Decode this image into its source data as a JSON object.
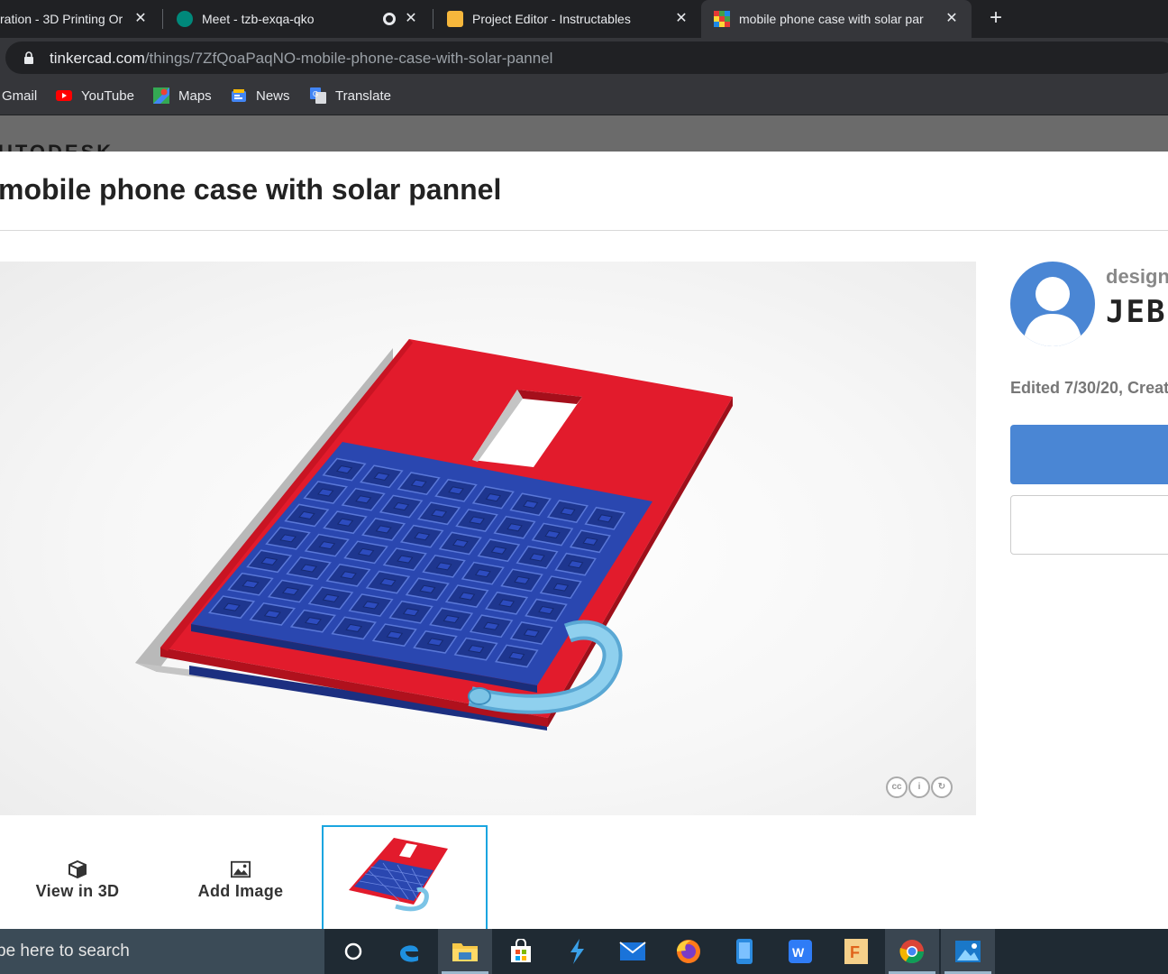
{
  "browser": {
    "tabs": [
      {
        "title": "ration - 3D Printing Or",
        "icon": "instructables-icon"
      },
      {
        "title": "Meet - tzb-exqa-qko",
        "icon": "meet-icon"
      },
      {
        "title": "Project Editor - Instructables",
        "icon": "instructables-robot-icon"
      },
      {
        "title": "mobile phone case with solar par",
        "icon": "tinkercad-icon"
      }
    ],
    "url_domain": "tinkercad.com",
    "url_path": "/things/7ZfQoaPaqNO-mobile-phone-case-with-solar-pannel",
    "bookmarks": [
      {
        "label": "Gmail",
        "icon": "gmail-icon"
      },
      {
        "label": "YouTube",
        "icon": "youtube-icon"
      },
      {
        "label": "Maps",
        "icon": "maps-icon"
      },
      {
        "label": "News",
        "icon": "news-icon"
      },
      {
        "label": "Translate",
        "icon": "translate-icon"
      }
    ],
    "close_glyph": "✕",
    "new_tab_glyph": "+"
  },
  "page": {
    "brand": "UTODESK",
    "title": "mobile phone case with solar pannel",
    "designer_label": "design",
    "author": "JEBI",
    "edited": "Edited 7/30/20, Creat",
    "actions": {
      "view3d": "View in 3D",
      "add_image": "Add Image"
    },
    "license_icons": [
      "cc",
      "by",
      "sa"
    ],
    "colors": {
      "case_red": "#e01c2a",
      "solar_blue": "#2643a6",
      "strap_light_blue": "#7cc4e6",
      "accent_blue": "#4a86d4"
    }
  },
  "taskbar": {
    "search_placeholder": "pe here to search",
    "apps": [
      "cortana-icon",
      "edge-icon",
      "file-explorer-icon",
      "store-icon",
      "vscode-icon",
      "mail-icon",
      "firefox-icon",
      "phone-icon",
      "wps-icon",
      "fusion360-icon",
      "chrome-icon",
      "photos-icon"
    ]
  }
}
